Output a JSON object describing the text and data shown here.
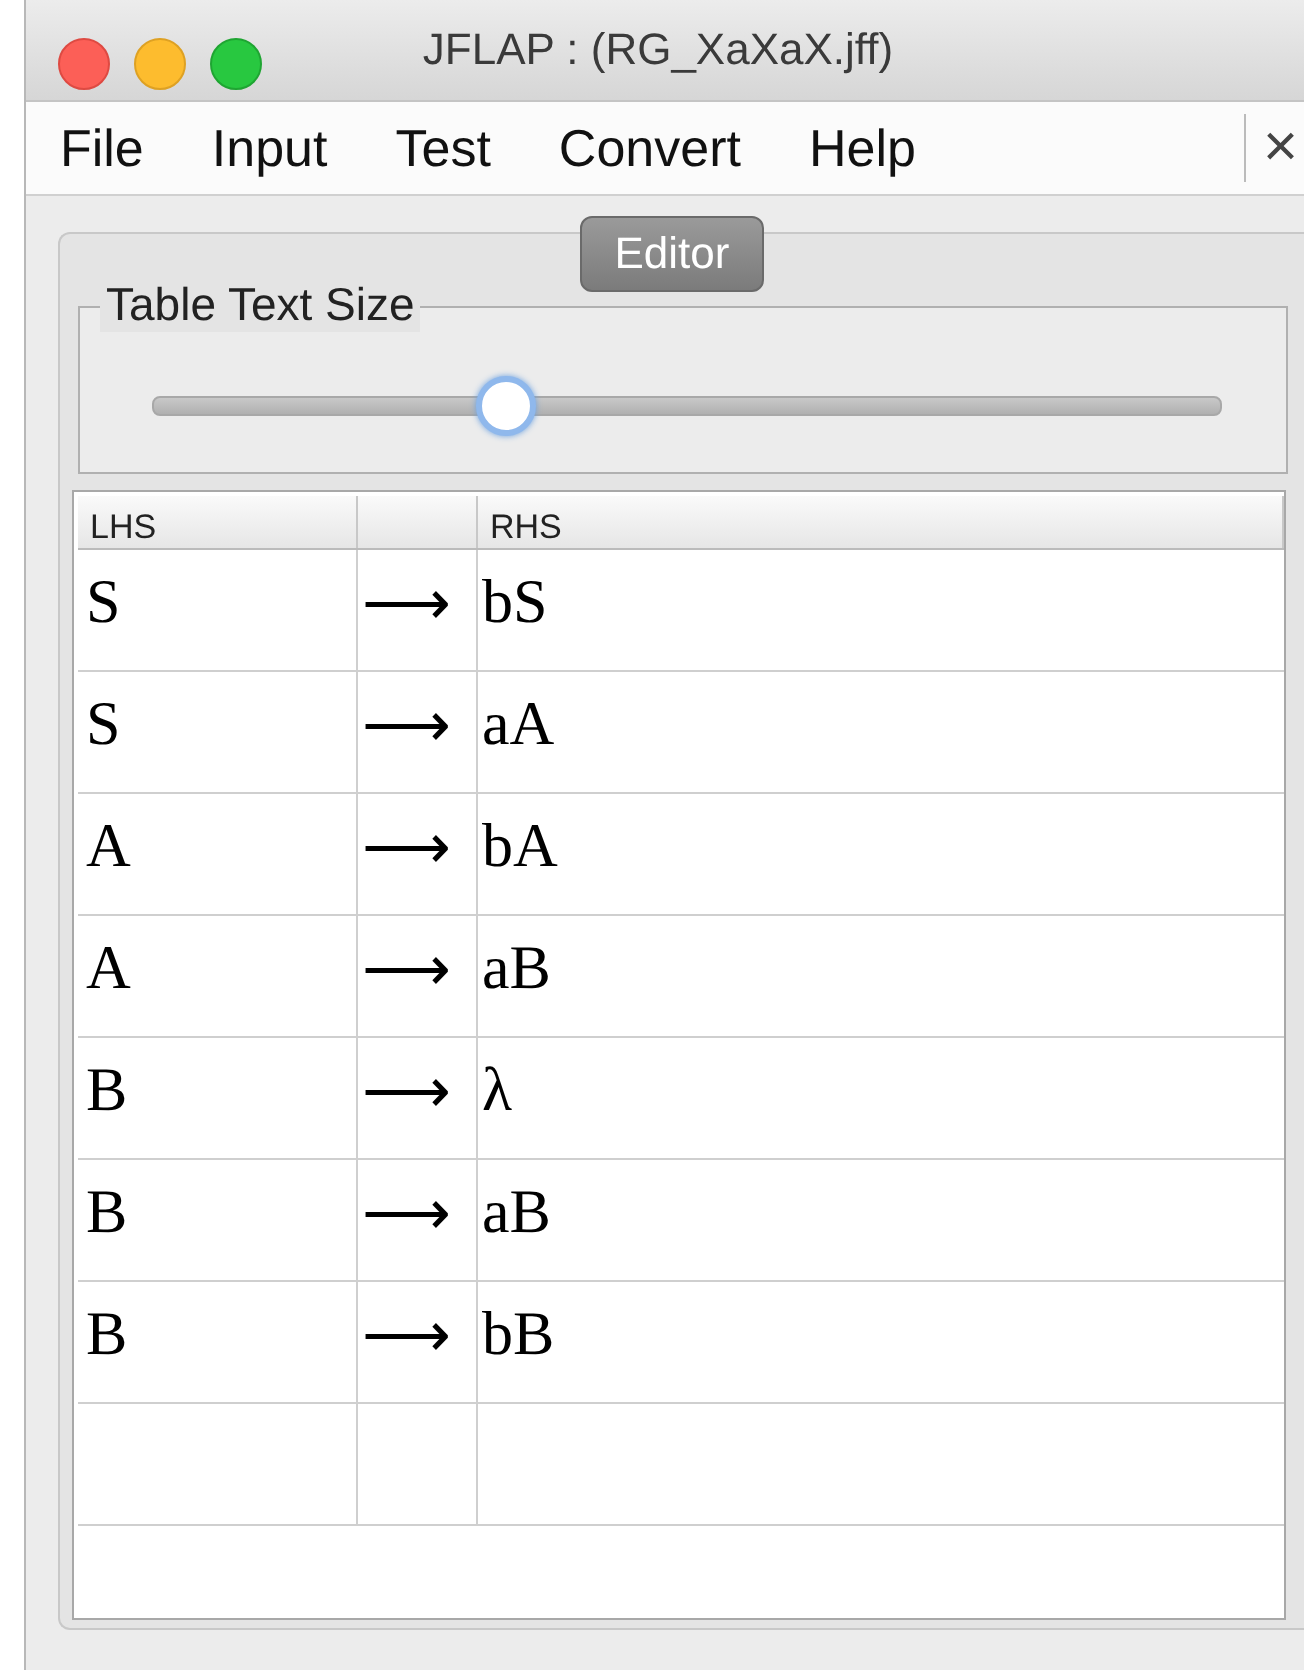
{
  "window": {
    "title": "JFLAP : (RG_XaXaX.jff)"
  },
  "menu": [
    "File",
    "Input",
    "Test",
    "Convert",
    "Help"
  ],
  "close_symbol": "×",
  "tabs": [
    {
      "label": "Editor",
      "selected": true
    }
  ],
  "text_size": {
    "label": "Table Text Size",
    "level": 0.33
  },
  "table": {
    "columns": [
      "LHS",
      "RHS"
    ],
    "rows": [
      {
        "lhs": "S",
        "arrow": "⟶",
        "rhs": "bS"
      },
      {
        "lhs": "S",
        "arrow": "⟶",
        "rhs": "aA"
      },
      {
        "lhs": "A",
        "arrow": "⟶",
        "rhs": "bA"
      },
      {
        "lhs": "A",
        "arrow": "⟶",
        "rhs": "aB"
      },
      {
        "lhs": "B",
        "arrow": "⟶",
        "rhs": "λ"
      },
      {
        "lhs": "B",
        "arrow": "⟶",
        "rhs": "aB"
      },
      {
        "lhs": "B",
        "arrow": "⟶",
        "rhs": "bB"
      }
    ]
  }
}
